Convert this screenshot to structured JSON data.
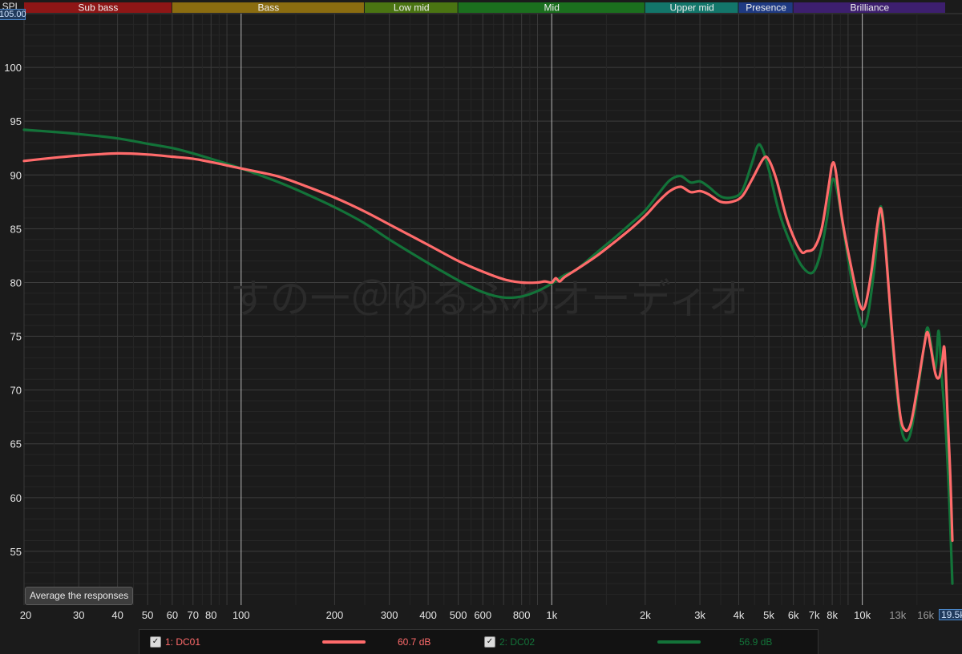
{
  "bands": [
    {
      "label": "Sub bass",
      "from": 20,
      "to": 60,
      "color": "#8e1616"
    },
    {
      "label": "Bass",
      "from": 60,
      "to": 250,
      "color": "#8a6c10"
    },
    {
      "label": "Low mid",
      "from": 250,
      "to": 500,
      "color": "#4a7412"
    },
    {
      "label": "Mid",
      "from": 500,
      "to": 2000,
      "color": "#1b6f1e"
    },
    {
      "label": "Upper mid",
      "from": 2000,
      "to": 4000,
      "color": "#13766a"
    },
    {
      "label": "Presence",
      "from": 4000,
      "to": 6000,
      "color": "#1f3a82"
    },
    {
      "label": "Brilliance",
      "from": 6000,
      "to": 20000,
      "color": "#3d1f6e"
    }
  ],
  "y_axis_label": "SPL",
  "y_top_box": "105.00",
  "x_right_box": "19.5k",
  "button_label": "Average the responses",
  "watermark": "すの一＠ゆるふわオーディオ",
  "colors": {
    "dc01": "#ff6b6b",
    "dc02": "#137339",
    "grid": "#3b3b3b",
    "background": "#1b1b1b"
  },
  "legend": [
    {
      "checked_icon": "checkbox-checked-icon",
      "name": "1: DC01",
      "value": "60.7 dB",
      "color": "#ff6b6b"
    },
    {
      "checked_icon": "checkbox-checked-icon",
      "name": "2: DC02",
      "value": "56.9 dB",
      "color": "#137339"
    }
  ],
  "chart_data": {
    "type": "line",
    "xlabel": "",
    "ylabel": "SPL",
    "x_scale": "log",
    "xlim": [
      20,
      19500
    ],
    "ylim": [
      50,
      105
    ],
    "grid": true,
    "yticks": [
      55,
      60,
      65,
      70,
      75,
      80,
      85,
      90,
      95,
      100
    ],
    "xticks": [
      {
        "v": 20,
        "label": "20"
      },
      {
        "v": 30,
        "label": "30"
      },
      {
        "v": 40,
        "label": "40"
      },
      {
        "v": 50,
        "label": "50"
      },
      {
        "v": 60,
        "label": "60"
      },
      {
        "v": 70,
        "label": "70"
      },
      {
        "v": 80,
        "label": "80"
      },
      {
        "v": 100,
        "label": "100"
      },
      {
        "v": 200,
        "label": "200"
      },
      {
        "v": 300,
        "label": "300"
      },
      {
        "v": 400,
        "label": "400"
      },
      {
        "v": 500,
        "label": "500"
      },
      {
        "v": 600,
        "label": "600"
      },
      {
        "v": 800,
        "label": "800"
      },
      {
        "v": 1000,
        "label": "1k"
      },
      {
        "v": 2000,
        "label": "2k"
      },
      {
        "v": 3000,
        "label": "3k"
      },
      {
        "v": 4000,
        "label": "4k"
      },
      {
        "v": 5000,
        "label": "5k"
      },
      {
        "v": 6000,
        "label": "6k"
      },
      {
        "v": 7000,
        "label": "7k"
      },
      {
        "v": 8000,
        "label": "8k"
      },
      {
        "v": 10000,
        "label": "10k"
      },
      {
        "v": 13000,
        "label": "13k"
      },
      {
        "v": 16000,
        "label": "16k"
      }
    ],
    "series": [
      {
        "name": "1: DC01",
        "color": "#ff6b6b",
        "points": [
          [
            20,
            91.3
          ],
          [
            25,
            91.6
          ],
          [
            30,
            91.8
          ],
          [
            40,
            92.0
          ],
          [
            50,
            91.9
          ],
          [
            60,
            91.7
          ],
          [
            70,
            91.5
          ],
          [
            80,
            91.2
          ],
          [
            100,
            90.6
          ],
          [
            130,
            89.9
          ],
          [
            160,
            89.0
          ],
          [
            200,
            87.9
          ],
          [
            250,
            86.6
          ],
          [
            300,
            85.4
          ],
          [
            400,
            83.5
          ],
          [
            500,
            82.0
          ],
          [
            600,
            81.0
          ],
          [
            700,
            80.3
          ],
          [
            800,
            80.0
          ],
          [
            900,
            80.0
          ],
          [
            950,
            80.1
          ],
          [
            1000,
            80.0
          ],
          [
            1030,
            80.4
          ],
          [
            1060,
            80.1
          ],
          [
            1100,
            80.5
          ],
          [
            1200,
            81.2
          ],
          [
            1400,
            82.5
          ],
          [
            1600,
            83.8
          ],
          [
            1800,
            85.0
          ],
          [
            2000,
            86.2
          ],
          [
            2200,
            87.5
          ],
          [
            2400,
            88.5
          ],
          [
            2600,
            88.9
          ],
          [
            2800,
            88.4
          ],
          [
            3000,
            88.5
          ],
          [
            3200,
            88.2
          ],
          [
            3500,
            87.5
          ],
          [
            3800,
            87.5
          ],
          [
            4100,
            88.0
          ],
          [
            4400,
            89.5
          ],
          [
            4800,
            91.5
          ],
          [
            5000,
            91.4
          ],
          [
            5300,
            89.5
          ],
          [
            5700,
            86.0
          ],
          [
            6100,
            83.8
          ],
          [
            6400,
            82.8
          ],
          [
            6600,
            82.9
          ],
          [
            7000,
            83.2
          ],
          [
            7400,
            85.0
          ],
          [
            7800,
            89.0
          ],
          [
            8000,
            91.0
          ],
          [
            8200,
            90.5
          ],
          [
            8600,
            86.0
          ],
          [
            9200,
            81.5
          ],
          [
            9800,
            78.0
          ],
          [
            10200,
            77.8
          ],
          [
            10700,
            81.0
          ],
          [
            11200,
            85.5
          ],
          [
            11500,
            86.8
          ],
          [
            11900,
            83.0
          ],
          [
            12500,
            75.0
          ],
          [
            13200,
            68.0
          ],
          [
            13700,
            66.3
          ],
          [
            14300,
            66.8
          ],
          [
            15000,
            70.0
          ],
          [
            15800,
            74.0
          ],
          [
            16200,
            75.4
          ],
          [
            16600,
            74.0
          ],
          [
            17200,
            71.5
          ],
          [
            17700,
            71.2
          ],
          [
            18100,
            72.8
          ],
          [
            18400,
            73.8
          ],
          [
            18800,
            68.0
          ],
          [
            19200,
            62.0
          ],
          [
            19500,
            56.0
          ]
        ]
      },
      {
        "name": "2: DC02",
        "color": "#137339",
        "points": [
          [
            20,
            94.2
          ],
          [
            25,
            94.0
          ],
          [
            30,
            93.8
          ],
          [
            40,
            93.4
          ],
          [
            50,
            92.9
          ],
          [
            60,
            92.5
          ],
          [
            70,
            92.0
          ],
          [
            80,
            91.5
          ],
          [
            100,
            90.6
          ],
          [
            130,
            89.4
          ],
          [
            160,
            88.3
          ],
          [
            200,
            87.0
          ],
          [
            250,
            85.5
          ],
          [
            300,
            84.0
          ],
          [
            400,
            81.8
          ],
          [
            500,
            80.2
          ],
          [
            600,
            79.1
          ],
          [
            700,
            78.6
          ],
          [
            800,
            78.7
          ],
          [
            900,
            79.2
          ],
          [
            1000,
            79.9
          ],
          [
            1100,
            80.7
          ],
          [
            1200,
            81.2
          ],
          [
            1400,
            82.8
          ],
          [
            1600,
            84.2
          ],
          [
            1800,
            85.5
          ],
          [
            2000,
            86.7
          ],
          [
            2200,
            88.2
          ],
          [
            2400,
            89.5
          ],
          [
            2600,
            89.9
          ],
          [
            2800,
            89.3
          ],
          [
            3000,
            89.4
          ],
          [
            3200,
            88.9
          ],
          [
            3500,
            88.0
          ],
          [
            3800,
            87.9
          ],
          [
            4100,
            88.5
          ],
          [
            4400,
            91.0
          ],
          [
            4600,
            92.7
          ],
          [
            4750,
            92.5
          ],
          [
            5000,
            90.5
          ],
          [
            5400,
            86.5
          ],
          [
            5900,
            83.5
          ],
          [
            6400,
            81.5
          ],
          [
            6900,
            80.9
          ],
          [
            7300,
            82.5
          ],
          [
            7700,
            86.0
          ],
          [
            8000,
            89.5
          ],
          [
            8300,
            88.5
          ],
          [
            8800,
            84.0
          ],
          [
            9400,
            79.0
          ],
          [
            10000,
            76.0
          ],
          [
            10400,
            76.8
          ],
          [
            10900,
            81.0
          ],
          [
            11300,
            85.5
          ],
          [
            11500,
            87.0
          ],
          [
            11900,
            83.5
          ],
          [
            12500,
            74.5
          ],
          [
            13200,
            67.5
          ],
          [
            13700,
            65.4
          ],
          [
            14300,
            66.0
          ],
          [
            15000,
            69.5
          ],
          [
            15800,
            74.0
          ],
          [
            16200,
            75.8
          ],
          [
            16600,
            74.5
          ],
          [
            17200,
            72.0
          ],
          [
            17600,
            75.5
          ],
          [
            18000,
            71.5
          ],
          [
            18600,
            66.0
          ],
          [
            19100,
            59.0
          ],
          [
            19500,
            52.0
          ]
        ]
      }
    ]
  }
}
